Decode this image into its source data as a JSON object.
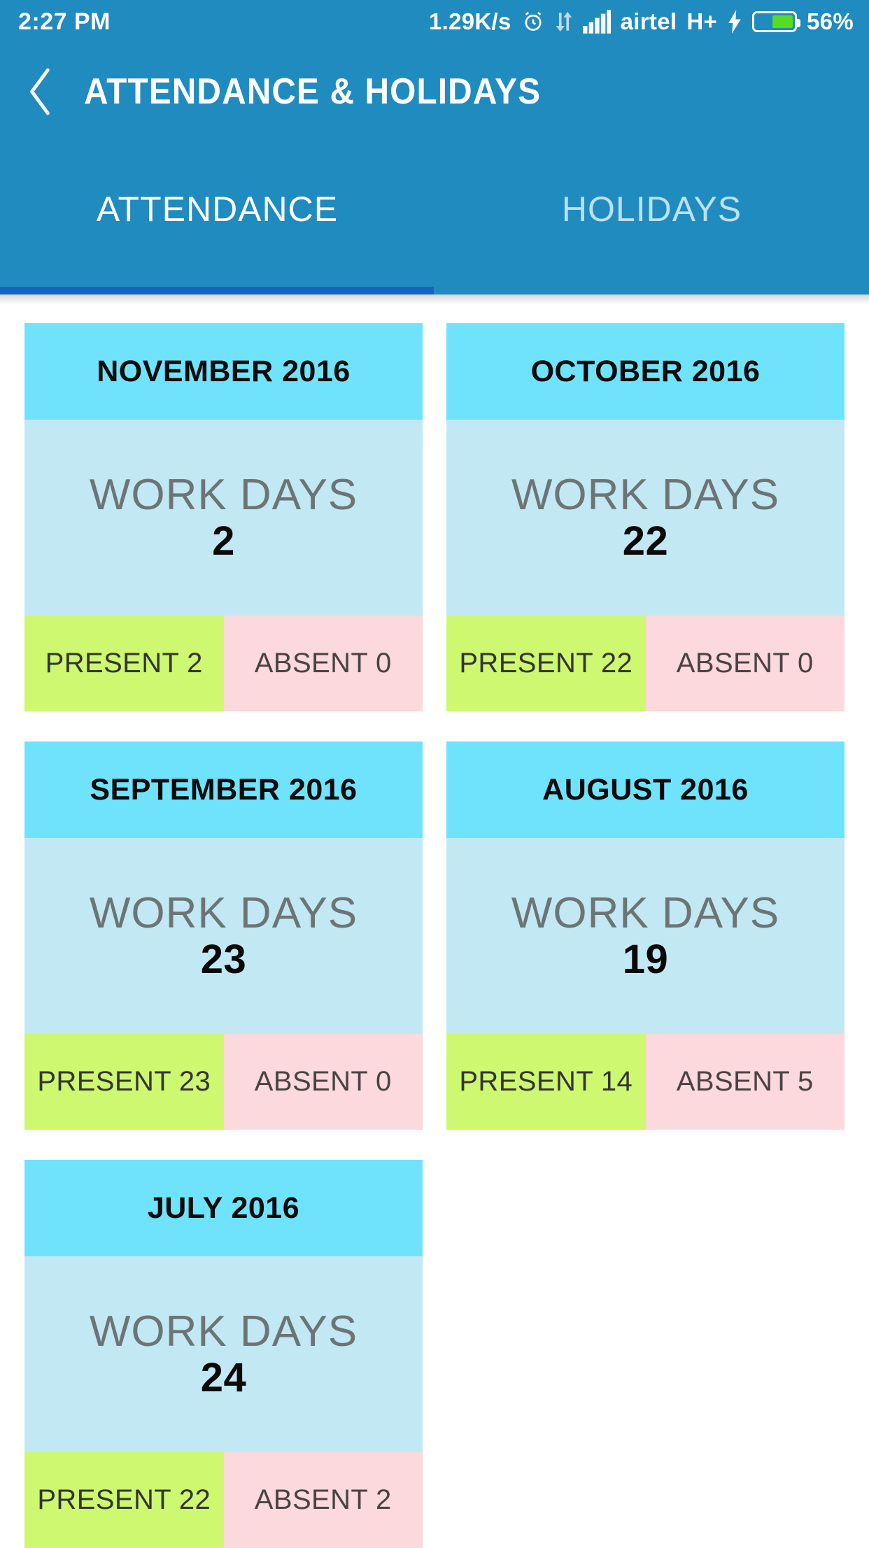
{
  "status_bar": {
    "time": "2:27 PM",
    "network_speed": "1.29K/s",
    "carrier": "airtel",
    "network_type": "H+",
    "battery_percent": "56%",
    "battery_level": 56,
    "icons": [
      "alarm-clock-icon",
      "data-transfer-icon",
      "signal-bars-icon",
      "charging-bolt-icon",
      "battery-icon"
    ]
  },
  "app_bar": {
    "back_icon": "chevron-left-icon",
    "title": "ATTENDANCE & HOLIDAYS"
  },
  "tabs": {
    "active_index": 0,
    "items": [
      {
        "label": "ATTENDANCE"
      },
      {
        "label": "HOLIDAYS"
      }
    ]
  },
  "content": {
    "work_days_label": "WORK DAYS",
    "cards": [
      {
        "month": "NOVEMBER 2016",
        "work_days": "2",
        "present": "PRESENT 2",
        "absent": "ABSENT 0"
      },
      {
        "month": "OCTOBER 2016",
        "work_days": "22",
        "present": "PRESENT 22",
        "absent": "ABSENT 0"
      },
      {
        "month": "SEPTEMBER 2016",
        "work_days": "23",
        "present": "PRESENT 23",
        "absent": "ABSENT 0"
      },
      {
        "month": "AUGUST 2016",
        "work_days": "19",
        "present": "PRESENT 14",
        "absent": "ABSENT 5"
      },
      {
        "month": "JULY 2016",
        "work_days": "24",
        "present": "PRESENT 22",
        "absent": "ABSENT 2"
      }
    ]
  },
  "colors": {
    "toolbar": "#1F8BBF",
    "tab_indicator": "#1565C0",
    "card_header": "#6FE3FB",
    "card_body": "#C2E8F4",
    "present": "#CDF870",
    "absent": "#FBD9DC",
    "battery_fill": "#55DD22"
  }
}
